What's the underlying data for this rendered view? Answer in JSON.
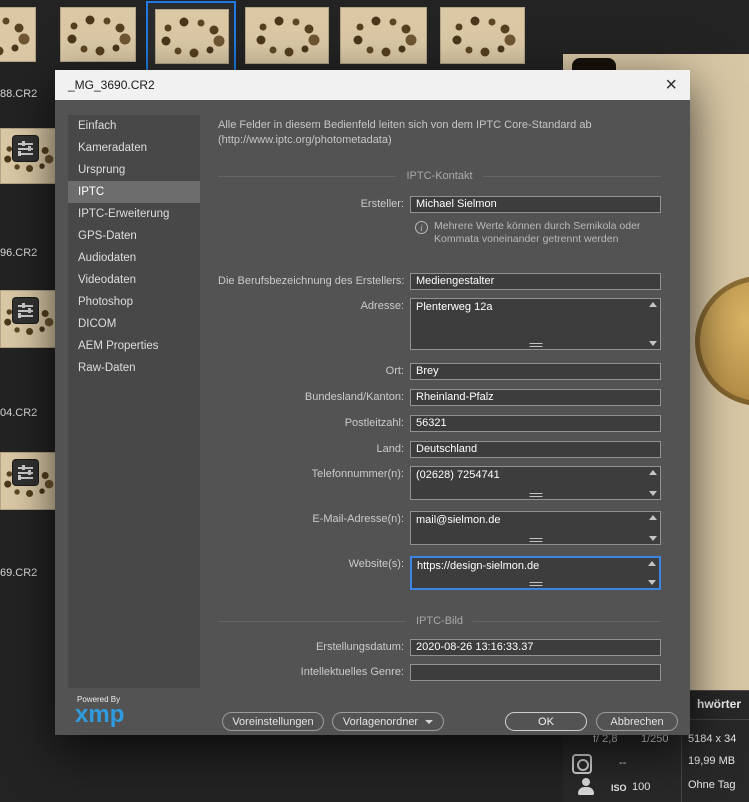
{
  "browser": {
    "files": [
      "88.CR2",
      "96.CR2",
      "04.CR2",
      "69.CR2"
    ]
  },
  "dialog": {
    "title": "_MG_3690.CR2",
    "close_label": "×",
    "sidebar": [
      "Einfach",
      "Kameradaten",
      "Ursprung",
      "IPTC",
      "IPTC-Erweiterung",
      "GPS-Daten",
      "Audiodaten",
      "Videodaten",
      "Photoshop",
      "DICOM",
      "AEM Properties",
      "Raw-Daten"
    ],
    "description": "Alle Felder in diesem Bedienfeld leiten sich von dem IPTC Core-Standard ab (http://www.iptc.org/photometadata)",
    "sections": {
      "contact_header": "IPTC-Kontakt",
      "image_header": "IPTC-Bild"
    },
    "fields": {
      "creator": {
        "label": "Ersteller:",
        "value": "Michael Sielmon"
      },
      "note": "Mehrere Werte können durch Semikola oder Kommata voneinander getrennt werden",
      "job_title": {
        "label": "Die Berufsbezeichnung des Erstellers:",
        "value": "Mediengestalter"
      },
      "address": {
        "label": "Adresse:",
        "value": "Plenterweg 12a"
      },
      "city": {
        "label": "Ort:",
        "value": "Brey"
      },
      "state": {
        "label": "Bundesland/Kanton:",
        "value": "Rheinland-Pfalz"
      },
      "postal_code": {
        "label": "Postleitzahl:",
        "value": "56321"
      },
      "country": {
        "label": "Land:",
        "value": "Deutschland"
      },
      "phone": {
        "label": "Telefonnummer(n):",
        "value": "(02628) 7254741"
      },
      "email": {
        "label": "E-Mail-Adresse(n):",
        "value": "mail@sielmon.de"
      },
      "website": {
        "label": "Website(s):",
        "value": "https://design-sielmon.de"
      },
      "creation_date": {
        "label": "Erstellungsdatum:",
        "value": "2020-08-26 13:16:33.37"
      },
      "genre": {
        "label": "Intellektuelles Genre:",
        "value": ""
      }
    },
    "footer": {
      "powered_by": "Powered By",
      "logo": "xmp",
      "buttons": {
        "presets": "Voreinstellungen",
        "template_folder": "Vorlagenordner",
        "ok": "OK",
        "cancel": "Abbrechen"
      }
    }
  },
  "placard": {
    "keywords_header": "hwörter",
    "aperture": "f/ 2,8",
    "shutter": "1/250",
    "dimensions": "5184 x 34",
    "file_size": "19,99 MB",
    "white_balance": "--",
    "iso_label": "ISO",
    "iso_value": "100",
    "tags": "Ohne Tag"
  }
}
